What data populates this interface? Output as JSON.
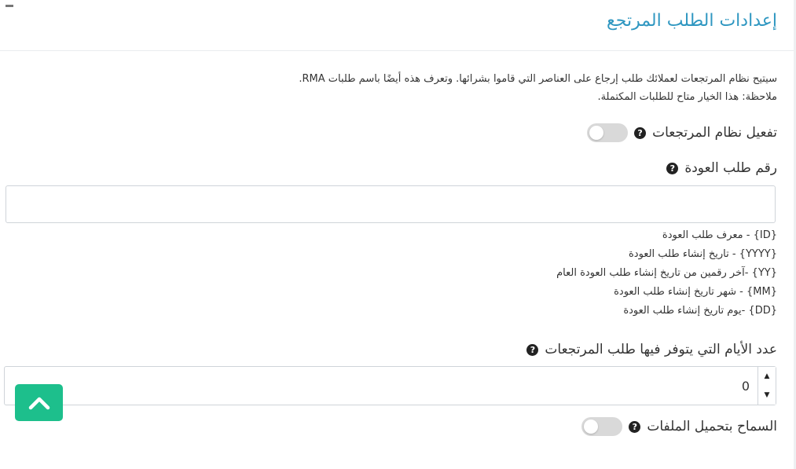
{
  "header": {
    "title": "إعدادات الطلب المرتجع",
    "collapse_icon": "minus-icon"
  },
  "description": {
    "line1": "سيتيح نظام المرتجعات لعملائك طلب إرجاع على العناصر التي قاموا بشرائها. وتعرف هذه أيضًا باسم طلبات RMA.",
    "line2": "ملاحظة: هذا الخيار متاح للطلبات المكتملة."
  },
  "enable_returns": {
    "label": "تفعيل نظام المرتجعات",
    "help_glyph": "?",
    "enabled": false
  },
  "return_number": {
    "label": "رقم طلب العودة",
    "help_glyph": "?",
    "value": "",
    "hints": [
      "{ID} - معرف طلب العودة",
      "{YYYY} - تاريخ إنشاء طلب العودة",
      "{YY} -آخر رقمين من تاريخ إنشاء طلب العودة العام",
      "{MM} - شهر تاريخ إنشاء طلب العودة",
      "{DD} -يوم تاريخ إنشاء طلب العودة"
    ]
  },
  "return_days": {
    "label": "عدد الأيام التي يتوفر فيها طلب المرتجعات",
    "help_glyph": "?",
    "value": "0",
    "up_glyph": "▲",
    "down_glyph": "▼"
  },
  "allow_uploads": {
    "label": "السماح بتحميل الملفات",
    "help_glyph": "?",
    "enabled": false
  },
  "back_to_top": {
    "icon": "chevron-up-icon",
    "color": "#1dbf8c"
  },
  "colors": {
    "title": "#2f97c1",
    "toggle_off": "#d9d9d9"
  }
}
